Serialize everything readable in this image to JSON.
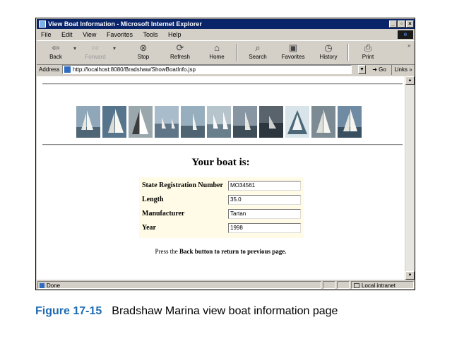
{
  "window": {
    "title": "View Boat Information - Microsoft Internet Explorer"
  },
  "menu": [
    "File",
    "Edit",
    "View",
    "Favorites",
    "Tools",
    "Help"
  ],
  "toolbar": {
    "back": "Back",
    "forward": "Forward",
    "stop": "Stop",
    "refresh": "Refresh",
    "home": "Home",
    "search": "Search",
    "favorites": "Favorites",
    "history": "History",
    "print": "Print"
  },
  "address": {
    "label": "Address",
    "url": "http://localhost:8080/Bradshaw/ShowBoatInfo.jsp",
    "go": "Go",
    "links": "Links"
  },
  "page": {
    "heading": "Your boat is:",
    "rows": [
      {
        "label": "State Registration Number",
        "value": "MO34561"
      },
      {
        "label": "Length",
        "value": "35.0"
      },
      {
        "label": "Manufacturer",
        "value": "Tartan"
      },
      {
        "label": "Year",
        "value": "1998"
      }
    ],
    "note_prefix": "Press the",
    "note_bold": "Back button to return to previous page."
  },
  "status": {
    "text": "Done",
    "zone": "Local intranet"
  },
  "caption": {
    "figure": "Figure 17-15",
    "text": "Bradshaw Marina view boat information page"
  },
  "icons": [
    "ie-page-icon",
    "back-icon",
    "forward-icon",
    "stop-icon",
    "refresh-icon",
    "home-icon",
    "search-icon",
    "favorites-icon",
    "history-icon",
    "print-icon",
    "go-arrow-icon"
  ],
  "photo_strip": [
    "sailboat-photo",
    "sailboat-photo",
    "sailboat-photo",
    "sailboat-photo",
    "sailboat-photo",
    "sailboat-photo",
    "sailboat-photo",
    "sailboat-photo",
    "sailboat-photo",
    "sailboat-photo",
    "sailboat-photo",
    "sailboat-photo"
  ],
  "colors": {
    "titlebar": "#0a246a",
    "figure_label": "#1f6bb0",
    "table_bg": "#fffbe6"
  }
}
